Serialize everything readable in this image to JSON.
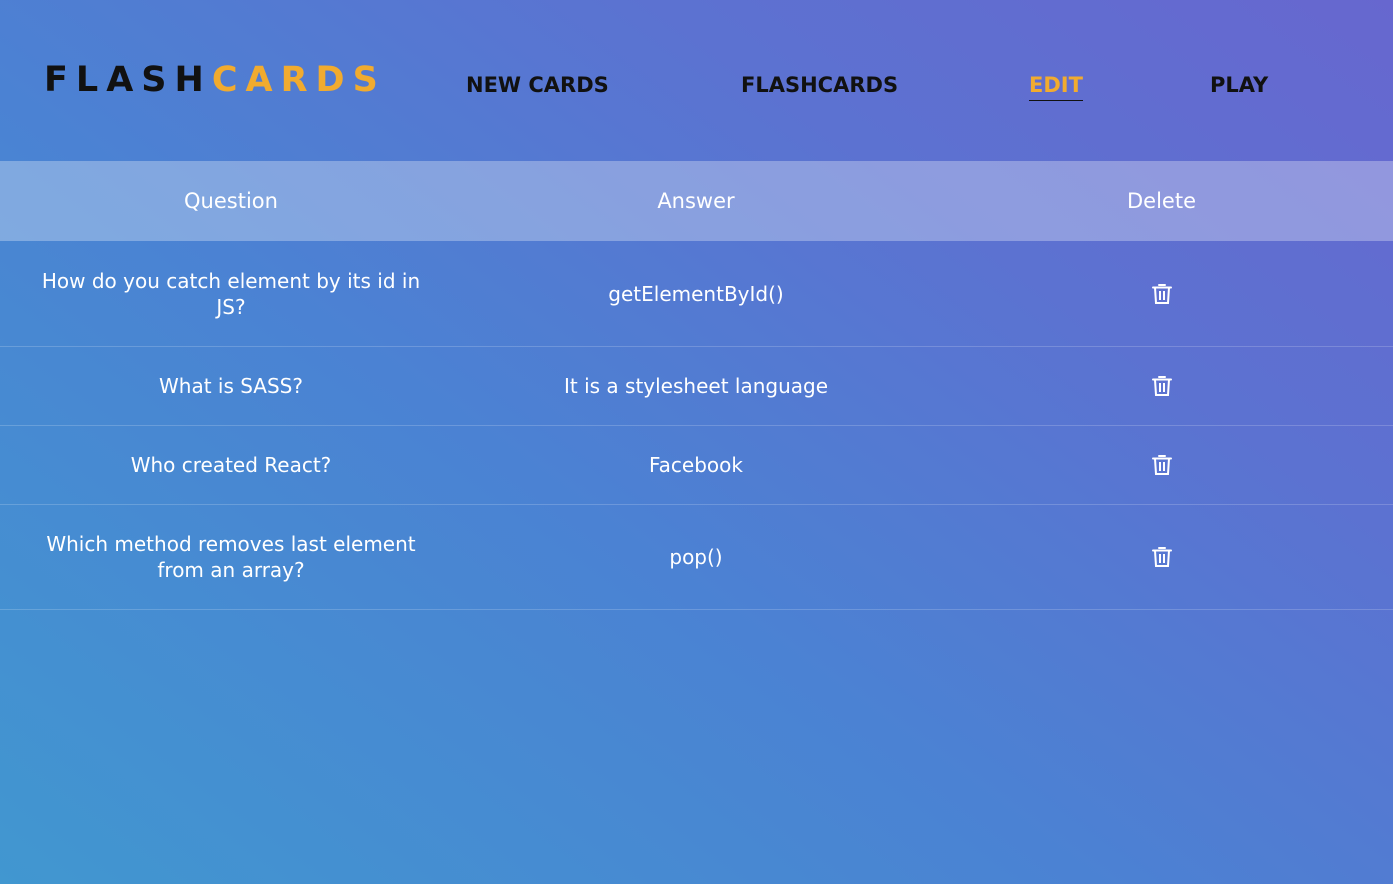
{
  "logo": {
    "part1": "FLASH",
    "part2": "CARDS"
  },
  "nav": {
    "new_cards": "NEW CARDS",
    "flashcards": "FLASHCARDS",
    "edit": "EDIT",
    "play": "PLAY",
    "active": "EDIT"
  },
  "table": {
    "headers": [
      "Question",
      "Answer",
      "Delete"
    ],
    "rows": [
      {
        "question": "How do you catch element by its id in JS?",
        "answer": "getElementById()",
        "delete_icon": "trash-icon"
      },
      {
        "question": "What is SASS?",
        "answer": "It is a stylesheet language",
        "delete_icon": "trash-icon"
      },
      {
        "question": "Who created React?",
        "answer": "Facebook",
        "delete_icon": "trash-icon"
      },
      {
        "question": "Which method removes last element from an array?",
        "answer": "pop()",
        "delete_icon": "trash-icon"
      }
    ]
  },
  "colors": {
    "accent": "#f1ab2f",
    "dark_text": "#111111",
    "gradient_start": "#4197d0",
    "gradient_end": "#6767cf"
  }
}
